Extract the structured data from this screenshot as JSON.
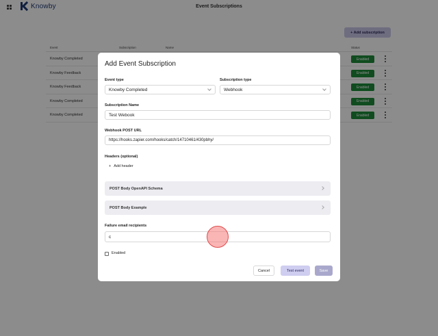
{
  "app": {
    "logo_text": "Knowby",
    "page_title": "Event Subscriptions",
    "add_subscription_label": "+ Add subscription"
  },
  "table": {
    "headers": {
      "event": "Event",
      "subscription": "Subscription",
      "name": "Name",
      "status": "Status"
    },
    "rows": [
      {
        "event": "Knowby Completed",
        "status": "Enabled"
      },
      {
        "event": "Knowby Feedback",
        "status": "Enabled"
      },
      {
        "event": "Knowby Feedback",
        "status": "Enabled"
      },
      {
        "event": "Knowby Completed",
        "status": "Enabled"
      },
      {
        "event": "Knowby Completed",
        "status": "Enabled"
      }
    ]
  },
  "modal": {
    "title": "Add Event Subscription",
    "event_type_label": "Event type",
    "event_type_value": "Knowby Completed",
    "subscription_type_label": "Subscription type",
    "subscription_type_value": "Webhook",
    "subscription_name_label": "Subscription Name",
    "subscription_name_value": "Test Webook",
    "webhook_url_label": "Webhook POST URL",
    "webhook_url_value": "https://hooks.zapier.com/hooks/catch/14710461/430pbhy/",
    "headers_label": "Headers (optional)",
    "add_header_label": "Add header",
    "accordion_schema": "POST Body OpenAPI Schema",
    "accordion_example": "POST Body Example",
    "failure_email_label": "Failure email recipients",
    "failure_email_value": "c",
    "enabled_label": "Enabled",
    "cancel_label": "Cancel",
    "test_event_label": "Test event",
    "save_label": "Save"
  },
  "colors": {
    "enabled_badge": "#1e8a3a",
    "accent": "#c9c6ea",
    "brand": "#1f3b73"
  }
}
